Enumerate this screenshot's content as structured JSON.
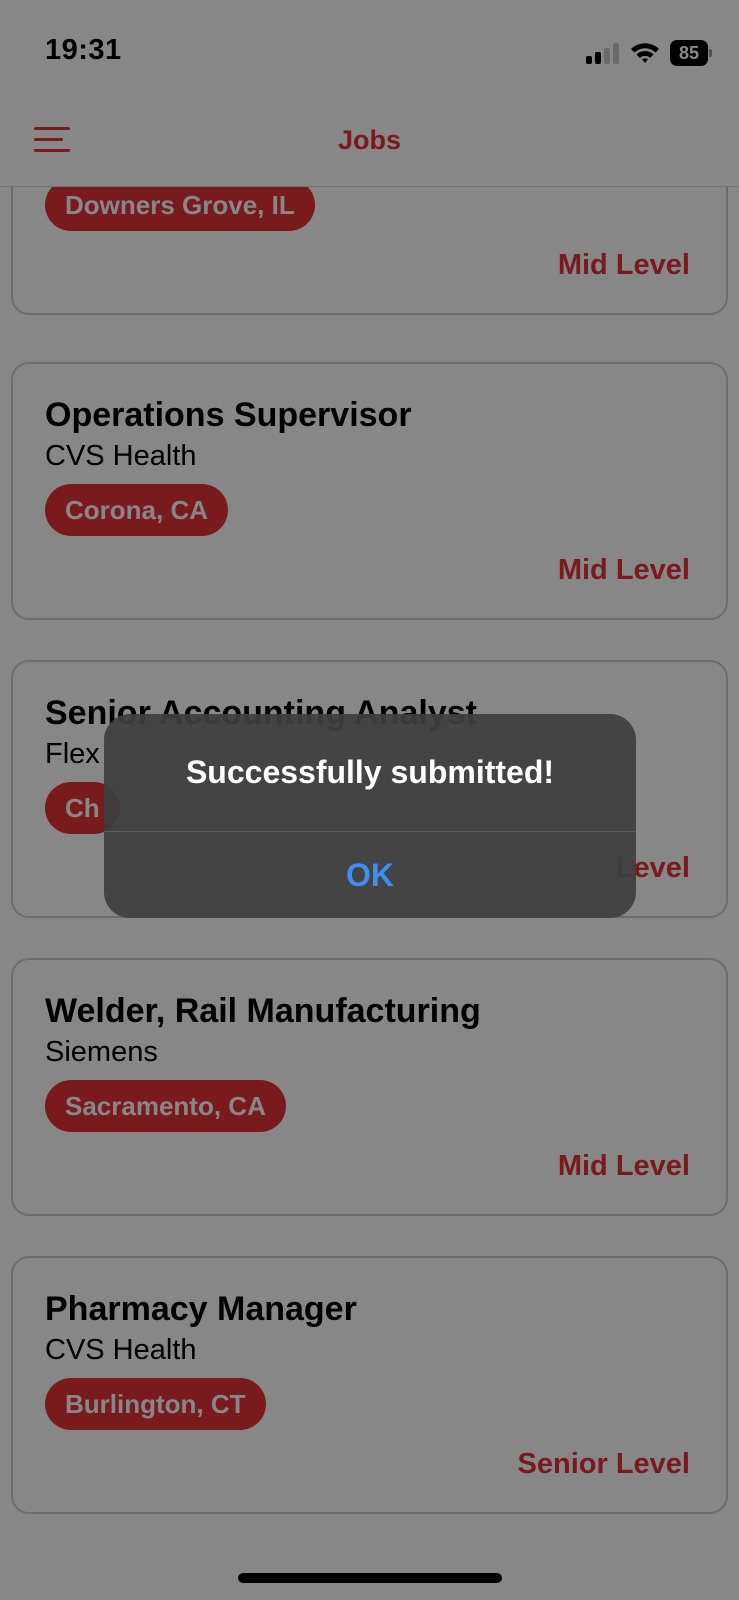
{
  "status_bar": {
    "time": "19:31",
    "battery_level": "85",
    "signal_bars_active": 2,
    "signal_bars_total": 4
  },
  "nav": {
    "title": "Jobs",
    "menu_icon": "hamburger-menu-icon"
  },
  "jobs": [
    {
      "title": "",
      "company": "",
      "location": "Downers Grove, IL",
      "level": "Mid Level"
    },
    {
      "title": "Operations Supervisor",
      "company": "CVS Health",
      "location": "Corona, CA",
      "level": "Mid Level"
    },
    {
      "title": "Senior Accounting Analyst",
      "company": "Flex",
      "location": "Ch",
      "level": "Level"
    },
    {
      "title": "Welder, Rail Manufacturing",
      "company": "Siemens",
      "location": "Sacramento, CA",
      "level": "Mid Level"
    },
    {
      "title": "Pharmacy Manager",
      "company": "CVS Health",
      "location": "Burlington, CT",
      "level": "Senior Level"
    }
  ],
  "alert": {
    "title": "Successfully submitted!",
    "ok_label": "OK"
  },
  "colors": {
    "accent": "#e53238",
    "alert_button": "#3d8ef8",
    "alert_bg": "#3e3e3e"
  }
}
